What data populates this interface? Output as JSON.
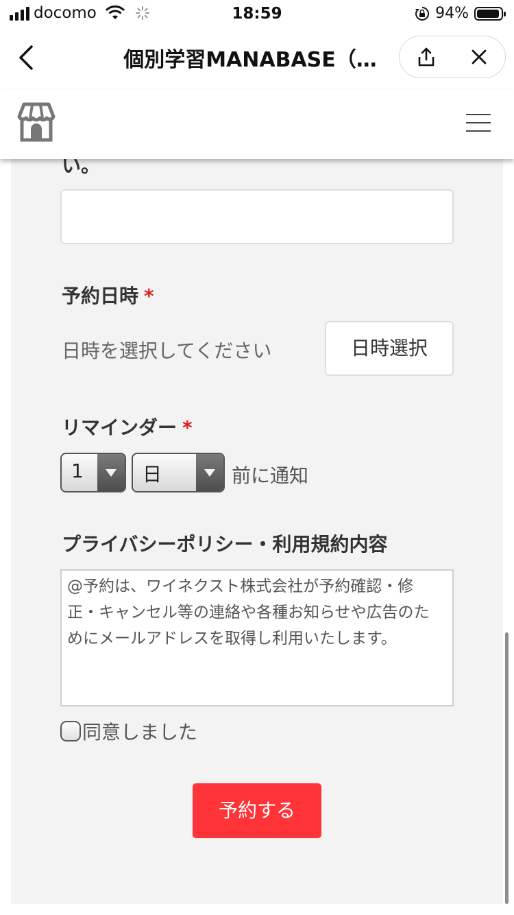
{
  "status_bar": {
    "carrier": "docomo",
    "time": "18:59",
    "battery_percent": "94%",
    "battery_level": 0.94,
    "icons": [
      "signal-icon",
      "wifi-icon",
      "loading-spinner-icon",
      "orientation-lock-icon",
      "battery-icon"
    ]
  },
  "nav": {
    "title": "個別学習MANABASE（…",
    "icons": [
      "chevron-left-icon",
      "share-icon",
      "close-icon"
    ]
  },
  "site_header": {
    "icons": [
      "store-icon",
      "hamburger-menu-icon"
    ]
  },
  "form": {
    "cut_off_text": "い。",
    "free_text_value": "",
    "datetime": {
      "label": "予約日時",
      "required_mark": "*",
      "placeholder": "日時を選択してください",
      "button_label": "日時選択"
    },
    "reminder": {
      "label": "リマインダー",
      "required_mark": "*",
      "amount": "1",
      "unit": "日",
      "suffix": "前に通知"
    },
    "policy": {
      "label": "プライバシーポリシー・利用規約内容",
      "line1": "@予約は、ワイネクスト株式会社が予約確認・修",
      "line2": "正・キャンセル等の連絡や各種お知らせや広告のた",
      "line3": "めにメールアドレスを取得し利用いたします。"
    },
    "agree_label": "同意しました",
    "agree_checked": false,
    "submit_label": "予約する"
  },
  "colors": {
    "accent_red": "#ff3438",
    "required_red": "#e02020",
    "content_bg": "#f3f3f3"
  }
}
